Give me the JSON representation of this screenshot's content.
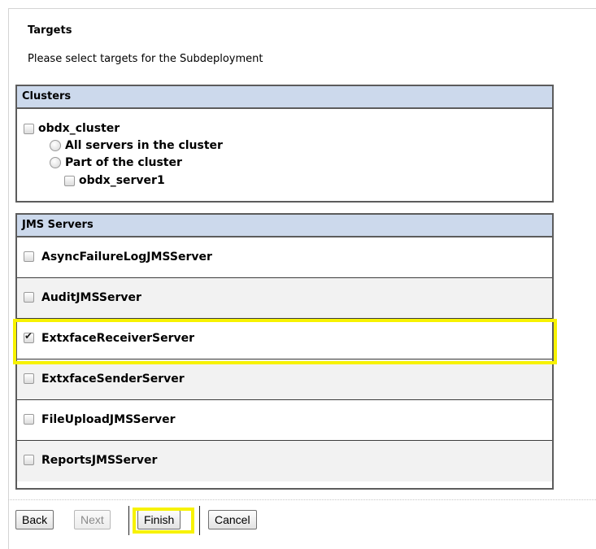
{
  "heading": "Targets",
  "instruction": "Please select targets for the Subdeployment",
  "clusters": {
    "header": "Clusters",
    "cluster_name": "obdx_cluster",
    "option_all": "All servers in the cluster",
    "option_part": "Part of the cluster",
    "server": "obdx_server1"
  },
  "jms": {
    "header": "JMS Servers",
    "items": [
      {
        "label": "AsyncFailureLogJMSServer",
        "checked": false
      },
      {
        "label": "AuditJMSServer",
        "checked": false
      },
      {
        "label": "ExtxfaceReceiverServer",
        "checked": true
      },
      {
        "label": "ExtxfaceSenderServer",
        "checked": false
      },
      {
        "label": "FileUploadJMSServer",
        "checked": false
      },
      {
        "label": "ReportsJMSServer",
        "checked": false
      }
    ]
  },
  "buttons": {
    "back": "Back",
    "next": "Next",
    "finish": "Finish",
    "cancel": "Cancel"
  },
  "highlight_color": "#f7f200",
  "header_bg": "#ccd9ec"
}
